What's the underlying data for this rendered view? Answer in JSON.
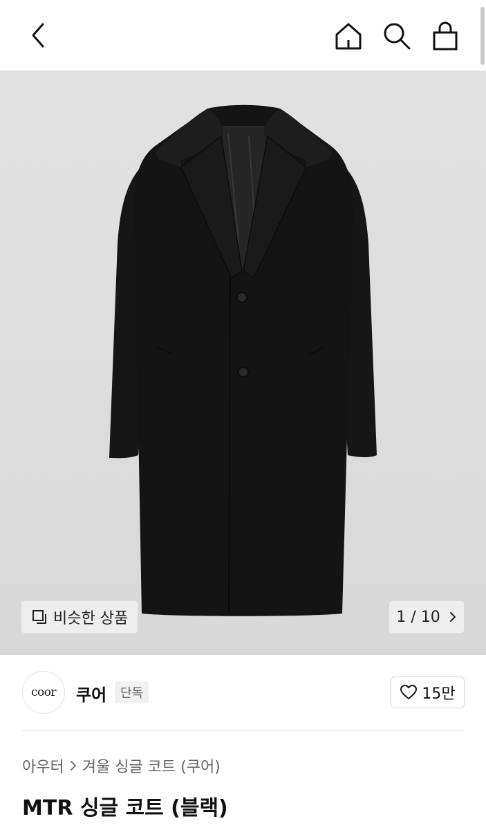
{
  "header": {
    "back_icon": "chevron-left-icon",
    "home_icon": "home-icon",
    "search_icon": "search-icon",
    "bag_icon": "shopping-bag-icon"
  },
  "gallery": {
    "image_subject": "black single-breasted long coat",
    "similar_label": "비슷한 상품",
    "similar_icon": "similar-items-icon",
    "current_page": "1",
    "total_pages": "10",
    "pager_label": "1 / 10",
    "next_icon": "chevron-right-icon"
  },
  "brand": {
    "logo_text": "coor",
    "name": "쿠어",
    "badge": "단독",
    "like_icon": "heart-icon",
    "like_count": "15만"
  },
  "product": {
    "breadcrumb": [
      "아우터",
      "겨울 싱글 코트 (쿠어)"
    ],
    "title": "MTR 싱글 코트 (블랙)"
  },
  "colors": {
    "hero_background": "#dddddd",
    "coat": "#141414",
    "text_primary": "#111111",
    "text_secondary": "#666666"
  }
}
